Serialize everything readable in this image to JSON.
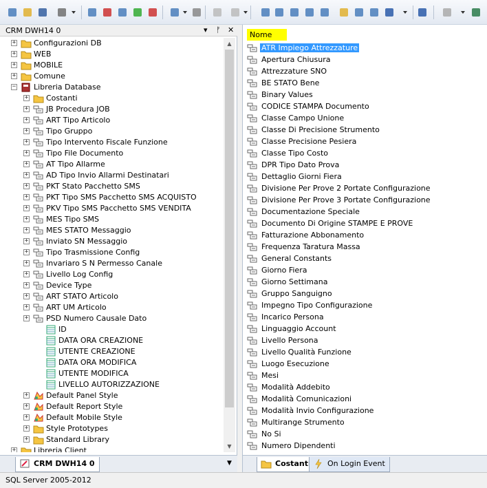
{
  "toolbar": {
    "buttons": [
      "new-icon",
      "open-icon",
      "save-icon",
      "tools-icon",
      "copy-icon",
      "delete-icon",
      "edit-icon",
      "check-icon",
      "cancel-icon",
      "find-icon",
      "tree-icon",
      "undo-icon",
      "redo-icon",
      "layout-icon",
      "layout-rows-icon",
      "layout-cols-icon",
      "grid-icon",
      "list-icon",
      "tile-icon",
      "sql-icon",
      "refresh-icon",
      "details-icon",
      "help-icon",
      "back-icon",
      "forward-icon",
      "panel-icon"
    ]
  },
  "left": {
    "title": "CRM DWH14 0",
    "pin": "▾ ⊣ ✕",
    "tree": [
      {
        "label": "Configurazioni DB",
        "icon": "folder-icon",
        "level": 0,
        "expander": "+"
      },
      {
        "label": "WEB",
        "icon": "folder-icon",
        "level": 0,
        "expander": "+"
      },
      {
        "label": "MOBILE",
        "icon": "folder-icon",
        "level": 0,
        "expander": "+"
      },
      {
        "label": "Comune",
        "icon": "folder-icon",
        "level": 0,
        "expander": "+"
      },
      {
        "label": "Libreria Database",
        "icon": "book-icon",
        "level": 0,
        "expander": "−"
      },
      {
        "label": "Costanti",
        "icon": "folder-icon",
        "level": 1,
        "expander": "+",
        "selected": true
      },
      {
        "label": "JB Procedura JOB",
        "icon": "table-icon",
        "level": 1,
        "expander": "+"
      },
      {
        "label": "ART Tipo Articolo",
        "icon": "table-icon",
        "level": 1,
        "expander": "+"
      },
      {
        "label": "Tipo Gruppo",
        "icon": "table-icon",
        "level": 1,
        "expander": "+"
      },
      {
        "label": "Tipo Intervento Fiscale Funzione",
        "icon": "table-icon",
        "level": 1,
        "expander": "+"
      },
      {
        "label": "Tipo File Documento",
        "icon": "table-icon",
        "level": 1,
        "expander": "+"
      },
      {
        "label": "AT Tipo Allarme",
        "icon": "table-icon",
        "level": 1,
        "expander": "+"
      },
      {
        "label": "AD Tipo Invio Allarmi Destinatari",
        "icon": "table-icon",
        "level": 1,
        "expander": "+"
      },
      {
        "label": "PKT Stato Pacchetto SMS",
        "icon": "table-icon",
        "level": 1,
        "expander": "+"
      },
      {
        "label": "PKT Tipo SMS Pacchetto SMS ACQUISTO",
        "icon": "table-icon",
        "level": 1,
        "expander": "+"
      },
      {
        "label": "PKV Tipo SMS Pacchetto SMS VENDITA",
        "icon": "table-icon",
        "level": 1,
        "expander": "+"
      },
      {
        "label": "MES Tipo SMS",
        "icon": "table-icon",
        "level": 1,
        "expander": "+"
      },
      {
        "label": "MES STATO Messaggio",
        "icon": "table-icon",
        "level": 1,
        "expander": "+"
      },
      {
        "label": "Inviato SN Messaggio",
        "icon": "table-icon",
        "level": 1,
        "expander": "+"
      },
      {
        "label": "Tipo Trasmissione Config",
        "icon": "table-icon",
        "level": 1,
        "expander": "+"
      },
      {
        "label": "Invariaro S N Permesso Canale",
        "icon": "table-icon",
        "level": 1,
        "expander": "+"
      },
      {
        "label": "Livello Log Config",
        "icon": "table-icon",
        "level": 1,
        "expander": "+"
      },
      {
        "label": "Device Type",
        "icon": "table-icon",
        "level": 1,
        "expander": "+"
      },
      {
        "label": "ART STATO Articolo",
        "icon": "table-icon",
        "level": 1,
        "expander": "+"
      },
      {
        "label": "ART UM Articolo",
        "icon": "table-icon",
        "level": 1,
        "expander": "+"
      },
      {
        "label": "PSD Numero Causale Dato",
        "icon": "table-icon",
        "level": 1,
        "expander": "+"
      },
      {
        "label": "ID",
        "icon": "column-icon",
        "level": 2,
        "expander": ""
      },
      {
        "label": "DATA ORA CREAZIONE",
        "icon": "column-icon",
        "level": 2,
        "expander": ""
      },
      {
        "label": "UTENTE CREAZIONE",
        "icon": "column-icon",
        "level": 2,
        "expander": ""
      },
      {
        "label": "DATA ORA MODIFICA",
        "icon": "column-icon",
        "level": 2,
        "expander": ""
      },
      {
        "label": "UTENTE MODIFICA",
        "icon": "column-icon",
        "level": 2,
        "expander": ""
      },
      {
        "label": "LIVELLO AUTORIZZAZIONE",
        "icon": "column-icon",
        "level": 2,
        "expander": ""
      },
      {
        "label": "Default Panel Style",
        "icon": "style-icon",
        "level": 1,
        "expander": "+"
      },
      {
        "label": "Default Report Style",
        "icon": "style-icon",
        "level": 1,
        "expander": "+"
      },
      {
        "label": "Default Mobile Style",
        "icon": "style-icon",
        "level": 1,
        "expander": "+"
      },
      {
        "label": "Style Prototypes",
        "icon": "folder-icon",
        "level": 1,
        "expander": "+"
      },
      {
        "label": "Standard Library",
        "icon": "folder-icon",
        "level": 1,
        "expander": "+"
      },
      {
        "label": "Libreria Client",
        "icon": "folder-icon",
        "level": 0,
        "expander": "+"
      }
    ],
    "tab_label": "CRM DWH14 0"
  },
  "right": {
    "column_header": "Nome",
    "items": [
      "ATR Impiego Attrezzature",
      "Apertura Chiusura",
      "Attrezzature SNO",
      "BE STATO Bene",
      "Binary Values",
      "CODICE STAMPA Documento",
      "Classe Campo Unione",
      "Classe Di Precisione Strumento",
      "Classe Precisione Pesiera",
      "Classe Tipo Costo",
      "DPR Tipo Dato Prova",
      "Dettaglio Giorni Fiera",
      "Divisione Per Prove 2 Portate Configurazione",
      "Divisione Per Prove 3 Portate Configurazione",
      "Documentazione Speciale",
      "Documento Di Origine STAMPE E PROVE",
      "Fatturazione Abbonamento",
      "Frequenza Taratura Massa",
      "General Constants",
      "Giorno Fiera",
      "Giorno Settimana",
      "Gruppo Sanguigno",
      "Impegno Tipo Configurazione",
      "Incarico Persona",
      "Linguaggio Account",
      "Livello Persona",
      "Livello Qualità Funzione",
      "Luogo Esecuzione",
      "Mesi",
      "Modalità Addebito",
      "Modalità Comunicazioni",
      "Modalità Invio Configurazione",
      "Multirange Strumento",
      "No Si",
      "Numero Dipendenti"
    ],
    "selected_index": 0,
    "tabs": [
      "Costanti",
      "On Login Event"
    ]
  },
  "status": {
    "text": "SQL Server 2005-2012"
  },
  "colors": {
    "selection": "#3399ff",
    "header_highlight": "#ffff00",
    "folder": "#f5c542"
  }
}
